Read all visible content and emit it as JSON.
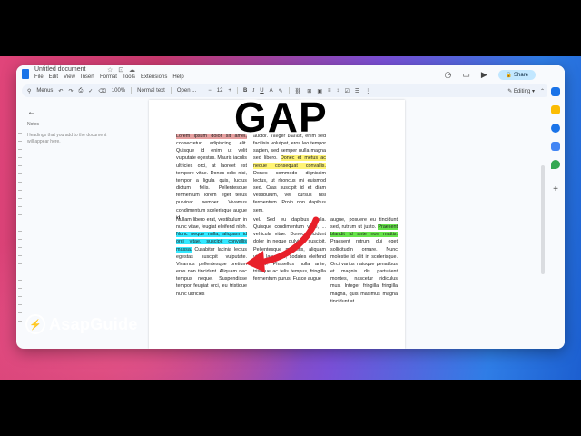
{
  "overlay": {
    "title": "GAP",
    "brand": "AsapGuide"
  },
  "doc": {
    "title": "Untitled document",
    "menu": [
      "File",
      "Edit",
      "View",
      "Insert",
      "Format",
      "Tools",
      "Extensions",
      "Help"
    ],
    "share_label": "Share",
    "toolbar": {
      "search": "Menus",
      "zoom": "100%",
      "style": "Normal text",
      "font": "Open ...",
      "font_size": "12",
      "mode": "Editing"
    },
    "outline": {
      "label": "Notes",
      "hint": "Headings that you add to the document will appear here."
    }
  },
  "columns": {
    "top": {
      "c1": {
        "highlight": "Lorem ipsum dolor sit amet,",
        "rest": " consectetur adipiscing elit. Quisque id enim ut velit vulputate egestas. Mauris iaculis ultricies orci, at laoreet est tempore vitae. Donec odio nisi, tempor a ligula quis, luctus dictum felis. Pellentesque fermentum lorem eget tellus pulvinar semper. Vivamus condimentum scelerisque augue id"
      },
      "c2": {
        "before": "auctor. Integer blandit, enim sed facilisis volutpat, eros leo tempor sapien, sed semper nulla magna sed libero. ",
        "highlight": "Donec et metus ac neque consequat convallis.",
        "after": " Donec commodo dignissim lectus, ut rhoncus mi euismod sed. Cras suscipit id et diam vestibulum, vel cursus nisl fermentum. Proin non dapibus sem."
      }
    },
    "bottom": {
      "c1": {
        "before": "Nullam libero erat, vestibulum in nunc vitae, feugiat eleifend nibh. ",
        "highlight": "Nunc neque nulla, aliquam id orci vitae, suscipit convallis massa.",
        "after": " Curabitur lacinia lectus egestas suscipit vulputate. Vivamus pellentesque pretium eros non tincidunt. Aliquam nec tempus neque. Suspendisse tempor feugiat orci, eu tristique nunc ultricies"
      },
      "c2": {
        "text": "vel. Sed eu dapibus nulla. Quisque condimentum vitae, ... vehicula vitae. Donec tincidunt dolor in neque pulvinar suscipit. Pellentesque mi felis, aliquam vitae lacus eu, sodales eleifend ipsum. Phasellus nulla ante, tristique ac felis tempus, fringilla fermentum purus. Fusce augue"
      },
      "c3": {
        "before": "augue, posuere eu tincidunt sed, rutrum ut justo. ",
        "highlight": "Praesent blandit id ante non mattis.",
        "after": " Praesent rutrum dui eget sollicitudin ornare. Nunc molestie id elit in scelerisque. Orci varius natoque penatibus et magnis dis parturient montes, nascetur ridiculus mus. Integer fringilla fringilla magna, quis maximus magna tincidunt at."
      }
    }
  },
  "colors": {
    "accent": "#1a73e8",
    "highlight_red": "#e6a0a0",
    "highlight_yellow": "#fff475",
    "highlight_cyan": "#33e8ff",
    "highlight_green": "#66e34a",
    "arrow": "#e8202a"
  }
}
